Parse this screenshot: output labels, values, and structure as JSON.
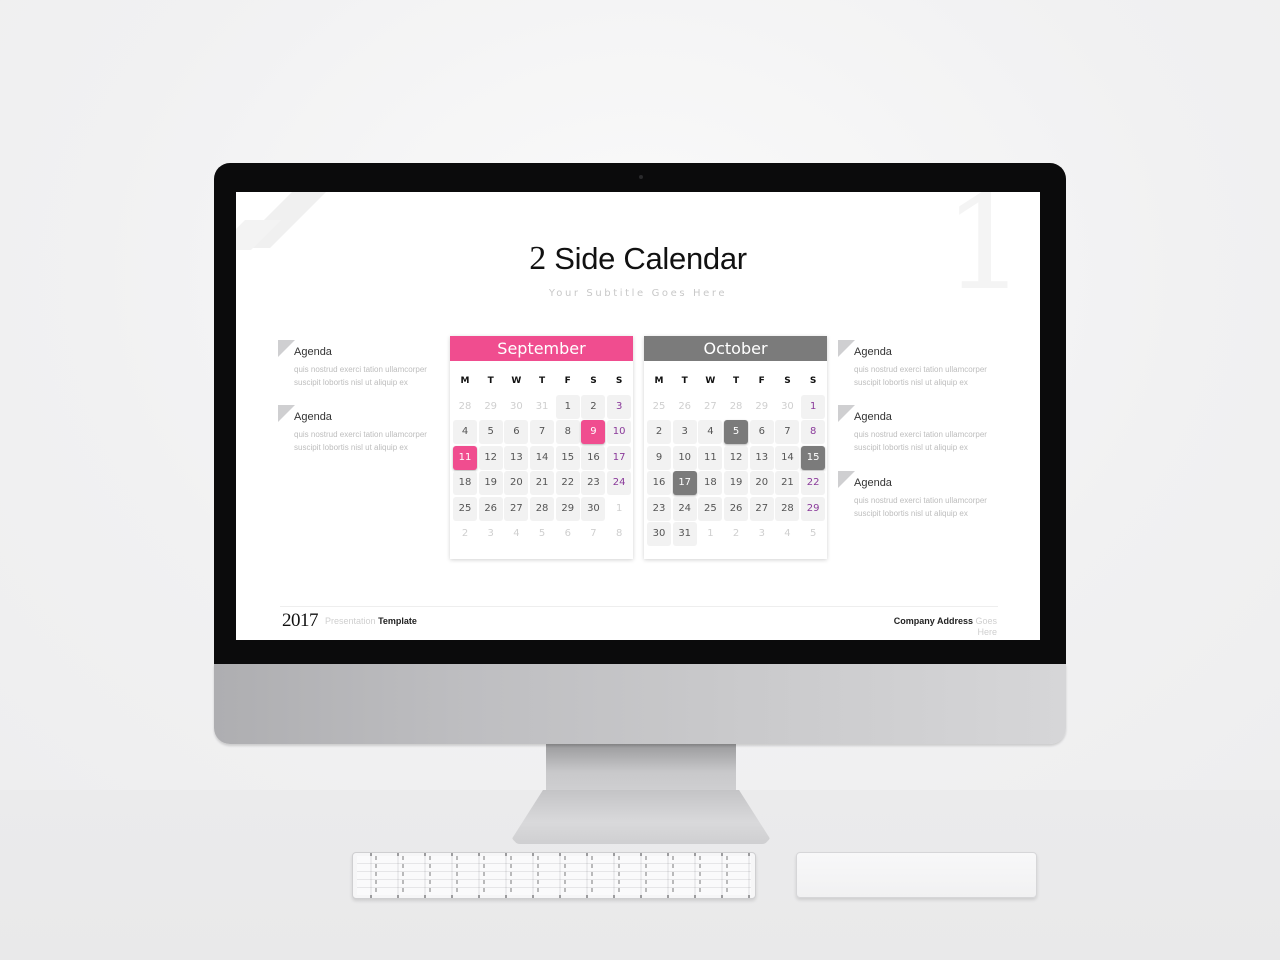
{
  "slide": {
    "title_number": "2",
    "title_text": "Side Calendar",
    "subtitle": "Your Subtitle Goes Here",
    "background_numeral": "1"
  },
  "agenda_left": [
    {
      "title": "Agenda",
      "text": "quis nostrud exerci tation ullamcorper suscipit lobortis nisl ut aliquip ex"
    },
    {
      "title": "Agenda",
      "text": "quis nostrud exerci tation ullamcorper suscipit lobortis nisl ut aliquip ex"
    }
  ],
  "agenda_right": [
    {
      "title": "Agenda",
      "text": "quis nostrud exerci tation ullamcorper suscipit lobortis nisl ut aliquip ex"
    },
    {
      "title": "Agenda",
      "text": "quis nostrud exerci tation ullamcorper suscipit lobortis nisl ut aliquip ex"
    },
    {
      "title": "Agenda",
      "text": "quis nostrud exerci tation ullamcorper suscipit lobortis nisl ut aliquip ex"
    }
  ],
  "colors": {
    "september_accent": "#f04d8f",
    "october_accent": "#7b7b7b",
    "sunday_text": "#8a3a9a"
  },
  "calendars": [
    {
      "month": "September",
      "weekdays": [
        "M",
        "T",
        "W",
        "T",
        "F",
        "S",
        "S"
      ],
      "days": [
        {
          "d": "28",
          "muted": true
        },
        {
          "d": "29",
          "muted": true
        },
        {
          "d": "30",
          "muted": true
        },
        {
          "d": "31",
          "muted": true
        },
        {
          "d": "1"
        },
        {
          "d": "2"
        },
        {
          "d": "3",
          "sun": true
        },
        {
          "d": "4"
        },
        {
          "d": "5"
        },
        {
          "d": "6"
        },
        {
          "d": "7"
        },
        {
          "d": "8"
        },
        {
          "d": "9",
          "highlight": true
        },
        {
          "d": "10",
          "sun": true
        },
        {
          "d": "11",
          "highlight": true
        },
        {
          "d": "12"
        },
        {
          "d": "13"
        },
        {
          "d": "14"
        },
        {
          "d": "15"
        },
        {
          "d": "16"
        },
        {
          "d": "17",
          "sun": true
        },
        {
          "d": "18"
        },
        {
          "d": "19"
        },
        {
          "d": "20"
        },
        {
          "d": "21"
        },
        {
          "d": "22"
        },
        {
          "d": "23"
        },
        {
          "d": "24",
          "sun": true
        },
        {
          "d": "25"
        },
        {
          "d": "26"
        },
        {
          "d": "27"
        },
        {
          "d": "28"
        },
        {
          "d": "29"
        },
        {
          "d": "30"
        },
        {
          "d": "1",
          "muted": true
        },
        {
          "d": "2",
          "muted": true
        },
        {
          "d": "3",
          "muted": true
        },
        {
          "d": "4",
          "muted": true
        },
        {
          "d": "5",
          "muted": true
        },
        {
          "d": "6",
          "muted": true
        },
        {
          "d": "7",
          "muted": true
        },
        {
          "d": "8",
          "muted": true
        }
      ]
    },
    {
      "month": "October",
      "weekdays": [
        "M",
        "T",
        "W",
        "T",
        "F",
        "S",
        "S"
      ],
      "days": [
        {
          "d": "25",
          "muted": true
        },
        {
          "d": "26",
          "muted": true
        },
        {
          "d": "27",
          "muted": true
        },
        {
          "d": "28",
          "muted": true
        },
        {
          "d": "29",
          "muted": true
        },
        {
          "d": "30",
          "muted": true
        },
        {
          "d": "1",
          "sun": true
        },
        {
          "d": "2"
        },
        {
          "d": "3"
        },
        {
          "d": "4"
        },
        {
          "d": "5",
          "highlight": true
        },
        {
          "d": "6"
        },
        {
          "d": "7"
        },
        {
          "d": "8",
          "sun": true
        },
        {
          "d": "9"
        },
        {
          "d": "10"
        },
        {
          "d": "11"
        },
        {
          "d": "12"
        },
        {
          "d": "13"
        },
        {
          "d": "14"
        },
        {
          "d": "15",
          "highlight": true
        },
        {
          "d": "16"
        },
        {
          "d": "17",
          "highlight": true
        },
        {
          "d": "18"
        },
        {
          "d": "19"
        },
        {
          "d": "20"
        },
        {
          "d": "21"
        },
        {
          "d": "22",
          "sun": true
        },
        {
          "d": "23"
        },
        {
          "d": "24"
        },
        {
          "d": "25"
        },
        {
          "d": "26"
        },
        {
          "d": "27"
        },
        {
          "d": "28"
        },
        {
          "d": "29",
          "sun": true
        },
        {
          "d": "30"
        },
        {
          "d": "31"
        },
        {
          "d": "1",
          "muted": true
        },
        {
          "d": "2",
          "muted": true
        },
        {
          "d": "3",
          "muted": true
        },
        {
          "d": "4",
          "muted": true
        },
        {
          "d": "5",
          "muted": true
        }
      ]
    }
  ],
  "footer": {
    "year": "2017",
    "presentation_light": "Presentation",
    "presentation_bold": "Template",
    "address_bold": "Company Address",
    "address_light": "Goes Here"
  }
}
